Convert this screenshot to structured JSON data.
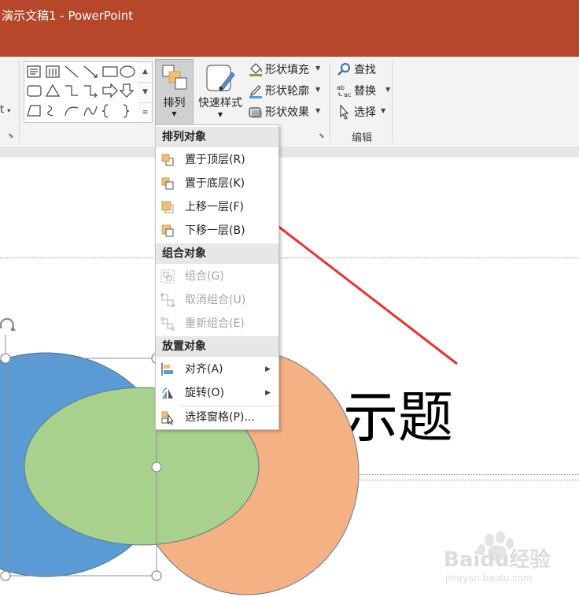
{
  "window": {
    "title": "演示文稿1 - PowerPoint"
  },
  "ribbon": {
    "left_clipped": "t",
    "arrange_label": "排列",
    "quick_styles_label": "快速样式",
    "shape_fill": "形状填充",
    "shape_outline": "形状轮廓",
    "shape_effects": "形状效果",
    "find": "查找",
    "replace": "替换",
    "select": "选择",
    "editing_group": "编辑"
  },
  "menu": {
    "section_arrange": "排列对象",
    "bring_to_front": "置于顶层(R)",
    "send_to_back": "置于底层(K)",
    "bring_forward": "上移一层(F)",
    "send_backward": "下移一层(B)",
    "section_group": "组合对象",
    "group": "组合(G)",
    "ungroup": "取消组合(U)",
    "regroup": "重新组合(E)",
    "section_position": "放置对象",
    "align": "对齐(A)",
    "rotate": "旋转(O)",
    "selection_pane": "选择窗格(P)..."
  },
  "slide": {
    "title_text": "示题"
  },
  "watermark": {
    "brand": "Baidu经验",
    "url": "jingyan.baidu.com"
  },
  "colors": {
    "titlebar": "#b7472a",
    "blue_shape": "#5b9bd5",
    "green_shape": "#a9d18e",
    "orange_shape": "#f4b183",
    "arrow": "#e8322f",
    "disabled_text": "#a6a6a6"
  }
}
